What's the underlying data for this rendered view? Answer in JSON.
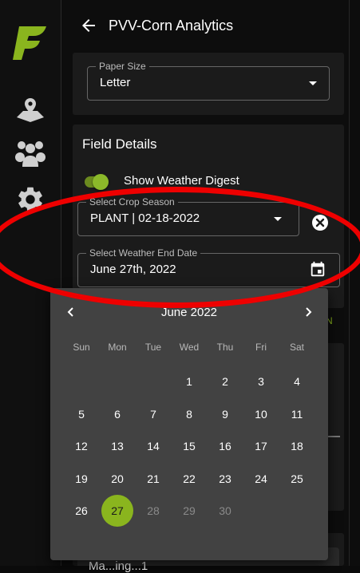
{
  "header": {
    "title": "PVV-Corn Analytics"
  },
  "sidebar": {
    "icons": [
      "location-icon",
      "group-icon",
      "gear-icon"
    ]
  },
  "paper_size": {
    "label": "Paper Size",
    "value": "Letter"
  },
  "field_details": {
    "title": "Field Details",
    "weather_digest": {
      "label": "Show Weather Digest",
      "enabled": true
    },
    "crop_season": {
      "label": "Select Crop Season",
      "value": "PLANT | 02-18-2022"
    },
    "weather_end_date": {
      "label": "Select Weather End Date",
      "value": "June 27th, 2022"
    }
  },
  "calendar": {
    "month_label": "June 2022",
    "weekdays": [
      "Sun",
      "Mon",
      "Tue",
      "Wed",
      "Thu",
      "Fri",
      "Sat"
    ],
    "first_weekday_index": 3,
    "days_in_month": 30,
    "selected_day": 27,
    "max_day": 27
  },
  "colors": {
    "accent": "#8ab51e",
    "annotation": "#ee0000"
  },
  "partial_text": {
    "edge_letter": "N",
    "bottom_label": "Ma...ing...1"
  }
}
